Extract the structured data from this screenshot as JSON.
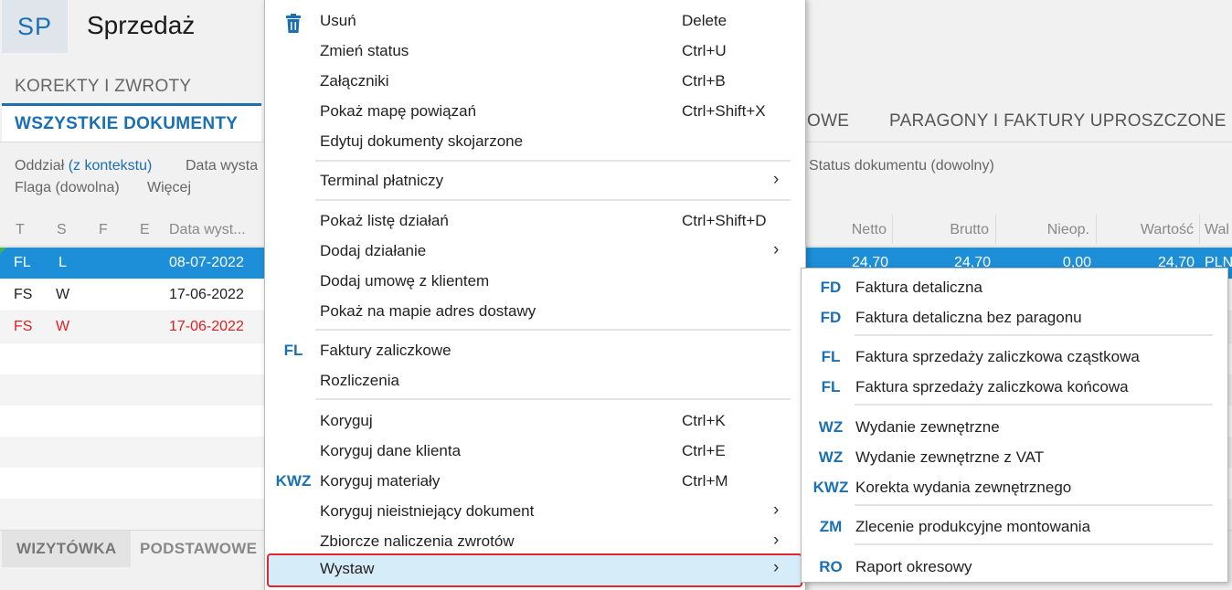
{
  "app": {
    "badge": "SP",
    "title": "Sprzedaż"
  },
  "subnav": {
    "label": "KOREKTY I ZWROTY"
  },
  "tabs": {
    "active": "WSZYSTKIE DOKUMENTY",
    "partial": "OWE",
    "paragony": "PARAGONY I FAKTURY UPROSZCZONE"
  },
  "filters": {
    "oddzial_label": "Oddział",
    "oddzial_value": "(z kontekstu)",
    "data_wyst": "Data wysta",
    "status": "Status dokumentu (dowolny)",
    "flaga": "Flaga (dowolna)",
    "wiecej": "Więcej"
  },
  "grid": {
    "headers": {
      "t": "T",
      "s": "S",
      "f": "F",
      "e": "E",
      "data": "Data wyst...",
      "netto": "Netto",
      "brutto": "Brutto",
      "nieop": "Nieop.",
      "wartosc": "Wartość",
      "wal": "Wal"
    },
    "rows": [
      {
        "t": "FL",
        "s": "L",
        "data": "08-07-2022",
        "netto": "24,70",
        "brutto": "24,70",
        "nieop": "0,00",
        "wartosc": "24,70",
        "wal": "PLN"
      },
      {
        "t": "FS",
        "s": "W",
        "data": "17-06-2022"
      },
      {
        "t": "FS",
        "s": "W",
        "data": "17-06-2022"
      }
    ]
  },
  "bottom_tabs": {
    "wizytowka": "WIZYTÓWKA",
    "podstawowe": "PODSTAWOWE"
  },
  "menu": {
    "usun": {
      "label": "Usuń",
      "shortcut": "Delete",
      "icon": "trash-icon"
    },
    "zmien_status": {
      "label": "Zmień status",
      "shortcut": "Ctrl+U"
    },
    "zalaczniki": {
      "label": "Załączniki",
      "shortcut": "Ctrl+B"
    },
    "mapa_powiazan": {
      "label": "Pokaż mapę powiązań",
      "shortcut": "Ctrl+Shift+X"
    },
    "edytuj_skojarzone": {
      "label": "Edytuj dokumenty skojarzone"
    },
    "terminal": {
      "label": "Terminal płatniczy",
      "arrow": "›"
    },
    "lista_dzialan": {
      "label": "Pokaż listę działań",
      "shortcut": "Ctrl+Shift+D"
    },
    "dodaj_dzialanie": {
      "label": "Dodaj działanie",
      "arrow": "›"
    },
    "dodaj_umowe": {
      "label": "Dodaj umowę z klientem"
    },
    "mapa_adres": {
      "label": "Pokaż na mapie adres dostawy"
    },
    "faktury_zaliczkowe": {
      "icon": "FL",
      "label": "Faktury zaliczkowe"
    },
    "rozliczenia": {
      "label": "Rozliczenia"
    },
    "koryguj": {
      "label": "Koryguj",
      "shortcut": "Ctrl+K"
    },
    "koryguj_dane": {
      "label": "Koryguj dane klienta",
      "shortcut": "Ctrl+E"
    },
    "koryguj_materialy": {
      "icon": "KWZ",
      "label": "Koryguj materiały",
      "shortcut": "Ctrl+M"
    },
    "koryguj_nieistniejacy": {
      "label": "Koryguj nieistniejący dokument",
      "arrow": "›"
    },
    "zbiorcze": {
      "label": "Zbiorcze naliczenia zwrotów",
      "arrow": "›"
    },
    "wystaw": {
      "label": "Wystaw",
      "arrow": "›"
    }
  },
  "submenu": [
    {
      "icon": "FD",
      "label": "Faktura detaliczna"
    },
    {
      "icon": "FD",
      "label": "Faktura detaliczna bez paragonu"
    },
    {
      "icon": "FL",
      "label": "Faktura sprzedaży zaliczkowa cząstkowa"
    },
    {
      "icon": "FL",
      "label": "Faktura sprzedaży zaliczkowa końcowa"
    },
    {
      "icon": "WZ",
      "label": "Wydanie zewnętrzne"
    },
    {
      "icon": "WZ",
      "label": "Wydanie zewnętrzne z VAT"
    },
    {
      "icon": "KWZ",
      "label": "Korekta wydania zewnętrznego"
    },
    {
      "icon": "ZM",
      "label": "Zlecenie produkcyjne montowania"
    },
    {
      "icon": "RO",
      "label": "Raport okresowy"
    }
  ],
  "colors": {
    "accent": "#1b6fb3",
    "selection": "#1d8fd9",
    "highlight": "#d7ecf9",
    "highlight_border": "#e3252d",
    "error_text": "#e02020"
  }
}
